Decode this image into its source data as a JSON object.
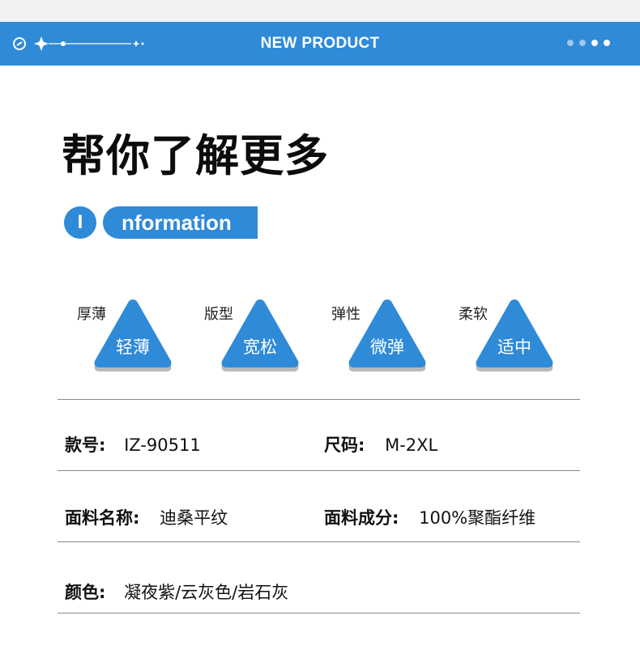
{
  "header": {
    "title": "NEW PRODUCT"
  },
  "main_title": "帮你了解更多",
  "info_badge": {
    "letter": "I",
    "word": "nformation"
  },
  "attributes": [
    {
      "label": "厚薄",
      "value": "轻薄"
    },
    {
      "label": "版型",
      "value": "宽松"
    },
    {
      "label": "弹性",
      "value": "微弹"
    },
    {
      "label": "柔软",
      "value": "适中"
    }
  ],
  "specs": {
    "style_no": {
      "label": "款号:",
      "value": "IZ-90511"
    },
    "size": {
      "label": "尺码:",
      "value": "M-2XL"
    },
    "fabric_name": {
      "label": "面料名称:",
      "value": "迪桑平纹"
    },
    "fabric_composition": {
      "label": "面料成分:",
      "value": "100%聚酯纤维"
    },
    "color": {
      "label": "颜色:",
      "value": "凝夜紫/云灰色/岩石灰"
    }
  },
  "colors": {
    "accent": "#2f8ad8",
    "divider": "#8a8a8a"
  },
  "icons": [
    "link-icon",
    "sparkle-star-icon",
    "carousel-dots-icon"
  ]
}
